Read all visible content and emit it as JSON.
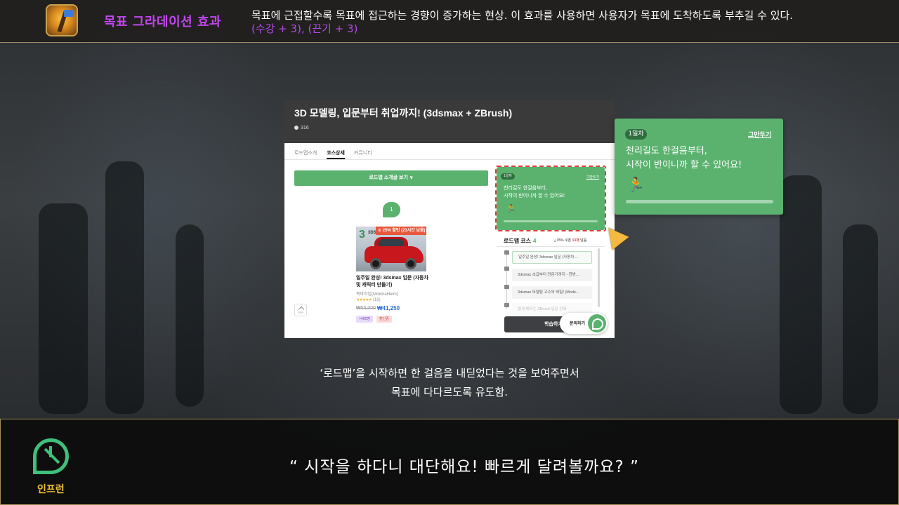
{
  "header": {
    "effect_title": "목표 그라데이션 효과",
    "description": "목표에 근접할수록 목표에 접근하는 경향이  증가하는 현상. 이 효과를 사용하면  사용자가 목표에 도착하도록 부추길 수 있다.",
    "stats": "(수강 + 3), (끈기 + 3)",
    "logo_icon": "golden-flag-badge-icon"
  },
  "screenshot": {
    "course_title": "3D 모델링, 입문부터 취업까지! (3dsmax + ZBrush)",
    "student_count": "316",
    "tabs": [
      {
        "label": "로드맵소개",
        "active": false
      },
      {
        "label": "코스상세",
        "active": true
      },
      {
        "label": "커뮤니티",
        "active": false
      }
    ],
    "roadmap_toggle": "로드맵 소개글 보기 ∨",
    "step_number": "1",
    "course_card": {
      "thumb_number": "3",
      "thumb_tag": "3DS",
      "discount_badge": "⊙ 25% 할인 (23시간 남음)",
      "title": "일주일 완성! 3dsmax 입문 (자동차 및 캐릭터 만들기)",
      "author": "목마히임(MokmaHeim)",
      "stars": "★★★★★",
      "rating_count": "(18)",
      "price_original": "₩55,000",
      "price_sale": "₩41,250",
      "tag_students": "+400명",
      "tag_discount": "할인중"
    },
    "top_button_label": "TOP",
    "mini_popup": {
      "day_label": "1일차",
      "close_label": "그만두기",
      "message_line1": "천리길도 한걸음부터,",
      "message_line2": "시작이 반이니까 할 수 있어요!",
      "runner_icon": "runner-icon"
    },
    "roadmap_course": {
      "title": "로드맵 코스",
      "count": "4",
      "coupon_prefix": "⤓ 35% 쿠폰 ",
      "coupon_highlight": "13개",
      "coupon_suffix": " 남음"
    },
    "roadmap_items": [
      "일주일 완성! 3dsmax 입문 (자동차 ...",
      "3dsmax 초급부터 전문가까지 - 한방...",
      "3dsmax 모델링 고수의 비밀! (Mode...",
      "쉽게 배우는 ZBrush 입문 강좌"
    ],
    "study_button": "학습하기",
    "inquiry_button": "문의하기"
  },
  "zoom_popup": {
    "day_label": "1일차",
    "close_label": "그만두기",
    "message_line1": "천리길도 한걸음부터,",
    "message_line2": "시작이 반이니까 할 수 있어요!",
    "runner_icon": "runner-icon",
    "progress": 0
  },
  "caption": {
    "line1": "‘로드맵’을 시작하면 한 걸음을 내딛었다는 것을 보여주면서",
    "line2": "목표에 다다르도록 유도함."
  },
  "dialog": {
    "brand_name": "인프런",
    "quote": "“ 시작을 하다니 대단해요! 빠르게 달려볼까요? ”"
  },
  "colors": {
    "effect_title": "#c246f0",
    "stats": "#b24be8",
    "popup_green": "#5bb26f",
    "brand_green": "#3fc07a",
    "brand_yellow": "#f1c232",
    "dashed_highlight": "#e33a3a"
  }
}
